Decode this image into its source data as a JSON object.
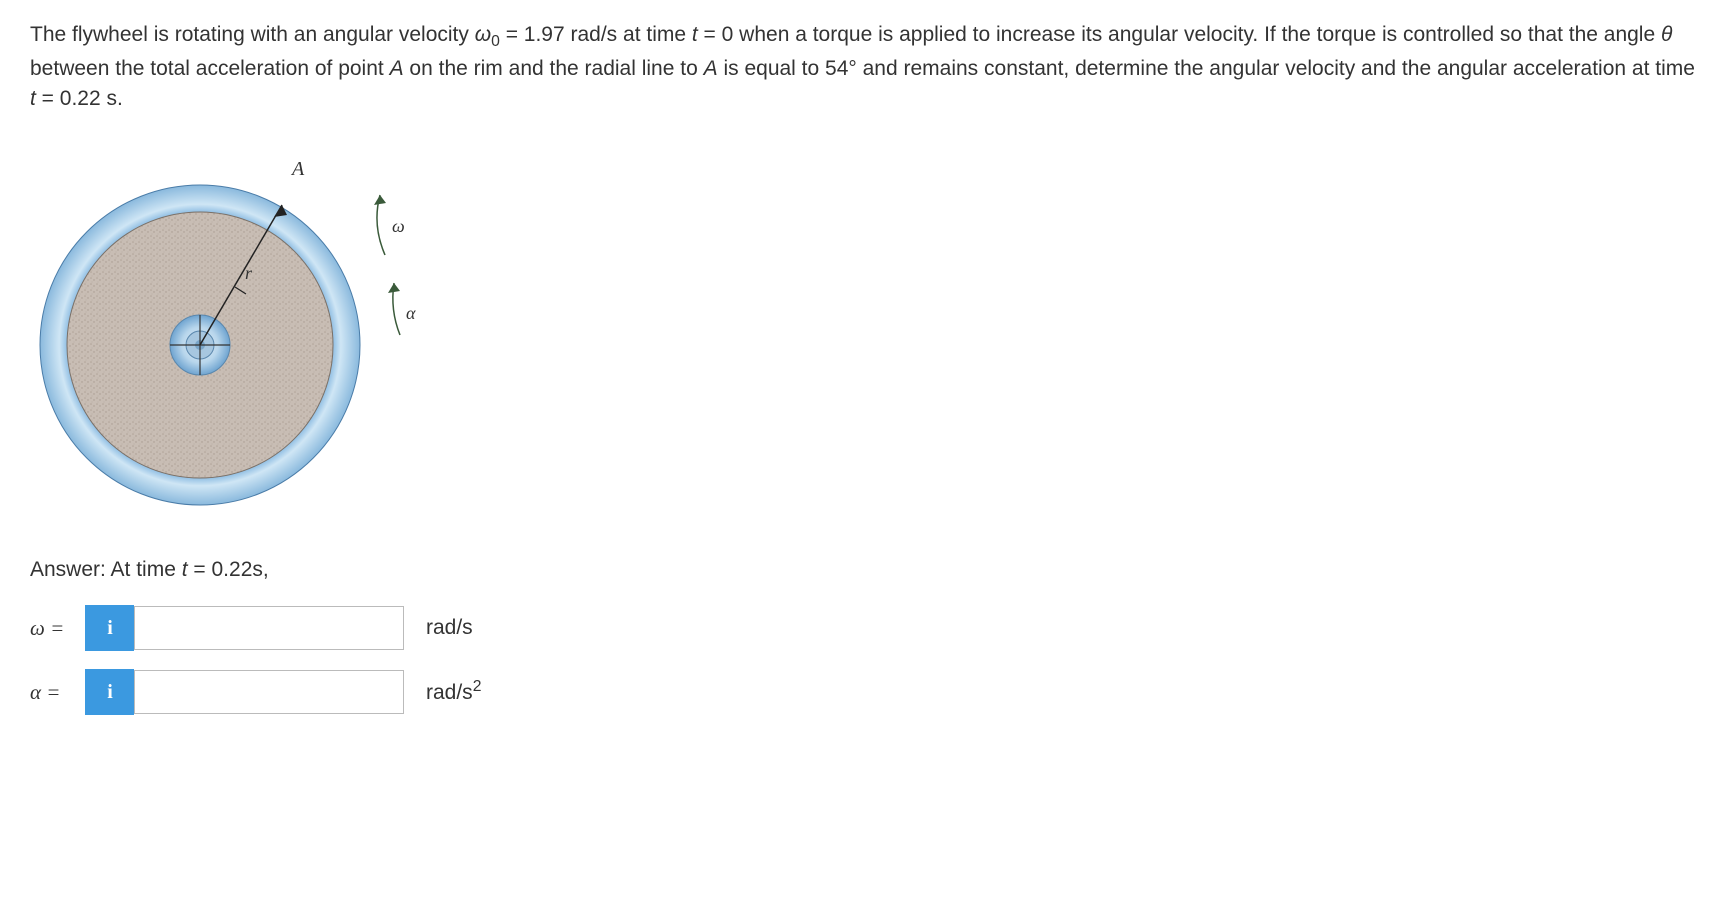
{
  "problem": {
    "text_html": "The flywheel is rotating with an angular velocity <i>ω</i><sub>0</sub> = 1.97 rad/s at time <i>t</i> = 0 when a torque is applied to increase its angular velocity. If the torque is controlled so that the angle <i>θ</i> between the total acceleration of point <i>A</i> on the rim and the radial line to <i>A</i> is equal to 54° and remains constant, determine the angular velocity and the angular acceleration at time <i>t</i> = 0.22 s."
  },
  "figure": {
    "label_A": "A",
    "label_r": "r",
    "label_omega": "ω",
    "label_alpha": "α"
  },
  "answer": {
    "prompt_html": "Answer: At time <i>t</i> = 0.22s,",
    "rows": [
      {
        "symbol": "ω =",
        "unit_html": "rad/s",
        "value": ""
      },
      {
        "symbol": "α =",
        "unit_html": "rad/s<sup>2</sup>",
        "value": ""
      }
    ],
    "info_icon": "i"
  }
}
